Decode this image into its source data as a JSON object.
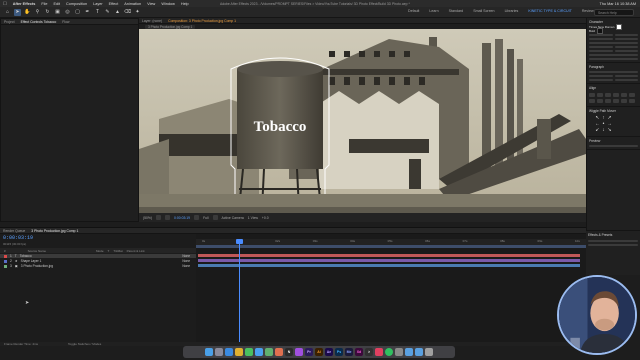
{
  "menubar": {
    "app": "After Effects",
    "items": [
      "File",
      "Edit",
      "Composition",
      "Layer",
      "Effect",
      "Animation",
      "View",
      "Window",
      "Help"
    ],
    "window_title": "Adobe After Effects 2023 - /Volumes/PROMPT SERIES/Files > Video/YouTube Tutorials/ 3D Photo Effect/Build 3D Photo.aep *",
    "clock": "Thu Mar 16 10:38 AM"
  },
  "toolbar": {
    "workspaces": [
      "Default",
      "Learn",
      "Standard",
      "Small Screen",
      "Libraries",
      "KINETIC TYPE & CIRCUIT",
      "Review"
    ],
    "active_workspace": "KINETIC TYPE & CIRCUIT",
    "search_placeholder": "Search Help"
  },
  "project_panel": {
    "tabs": [
      "Project",
      "Effect Controls Tobacco",
      "Flow"
    ]
  },
  "viewer": {
    "tabs": [
      "Layer: (none)",
      "Composition: 3 Photo Production.jpg Comp 1"
    ],
    "subtab": "3 Photo Production.jpg Comp 1",
    "overlay_text": "Tobacco",
    "footer": {
      "zoom": "(50%)",
      "time": "0:00:03:19",
      "quality": "Full",
      "camera": "Active Camera",
      "views": "1 View",
      "exposure": "+0.0"
    }
  },
  "right_panels": {
    "titles": [
      "Text",
      "Character",
      "Paragraph",
      "Align",
      "Wiggle Path Mover",
      "Preview",
      "Effects & Presets"
    ],
    "font": "Times New Roman",
    "font_style": "Bold"
  },
  "timeline": {
    "tabs": [
      "Render Queue",
      "3 Photo Production.jpg Comp 1"
    ],
    "timecode": "0:00:03:19",
    "frames": "00115 (30.00 fps)",
    "columns": [
      "#",
      "Source Name",
      "Mode",
      "T",
      "TrkMat",
      "Parent & Link"
    ],
    "layers": [
      {
        "num": "1",
        "name": "Tobacco",
        "color": "#d94a4a",
        "parent": "None"
      },
      {
        "num": "2",
        "name": "Shape Layer 1",
        "color": "#5b6ec9",
        "parent": "None"
      },
      {
        "num": "3",
        "name": "3 Photo Production.jpg",
        "color": "#6fae7a",
        "parent": "None"
      }
    ],
    "ruler_labels": [
      "0s",
      "01s",
      "02s",
      "03s",
      "04s",
      "05s",
      "06s",
      "07s",
      "08s",
      "09s",
      "10s"
    ],
    "track_colors": [
      "#c05858",
      "#7a5aa8",
      "#4a7ab0"
    ],
    "accent": "#4a8cff"
  },
  "status": {
    "left": "Frame Render Time: 4ms",
    "middle": "Toggle Switches / Modes"
  },
  "dock": {
    "icons": [
      {
        "name": "finder",
        "label": "",
        "color": "#4aa0e8"
      },
      {
        "name": "launchpad",
        "label": "",
        "color": "#8a8a9a"
      },
      {
        "name": "safari",
        "label": "",
        "color": "#3a8ae0"
      },
      {
        "name": "chrome",
        "label": "",
        "color": "#e0b030"
      },
      {
        "name": "messages",
        "label": "",
        "color": "#4ac060"
      },
      {
        "name": "mail",
        "label": "",
        "color": "#4aa0f0"
      },
      {
        "name": "maps",
        "label": "",
        "color": "#60b070"
      },
      {
        "name": "photos",
        "label": "",
        "color": "#e07050"
      },
      {
        "name": "notion",
        "label": "N",
        "color": "#2a2a2a"
      },
      {
        "name": "figma",
        "label": "",
        "color": "#a050e0"
      },
      {
        "name": "premiere",
        "label": "Pr",
        "color": "#2a1a5a"
      },
      {
        "name": "illustrator",
        "label": "Ai",
        "color": "#3a2000"
      },
      {
        "name": "after-effects",
        "label": "Ae",
        "color": "#1a0a4a"
      },
      {
        "name": "photoshop",
        "label": "Ps",
        "color": "#0a2a4a"
      },
      {
        "name": "media-encoder",
        "label": "Me",
        "color": "#1a1a3a"
      },
      {
        "name": "xd",
        "label": "Xd",
        "color": "#3a0a3a"
      },
      {
        "name": "terminal",
        "label": ">",
        "color": "#303030"
      },
      {
        "name": "music",
        "label": "",
        "color": "#e04060"
      },
      {
        "name": "spotify",
        "label": "",
        "color": "#30c060"
      },
      {
        "name": "system-settings",
        "label": "",
        "color": "#8a8a8a"
      },
      {
        "name": "folder",
        "label": "",
        "color": "#5aa0e0"
      },
      {
        "name": "downloads",
        "label": "",
        "color": "#5aa0e0"
      },
      {
        "name": "trash",
        "label": "",
        "color": "#a0a0a0"
      }
    ]
  }
}
